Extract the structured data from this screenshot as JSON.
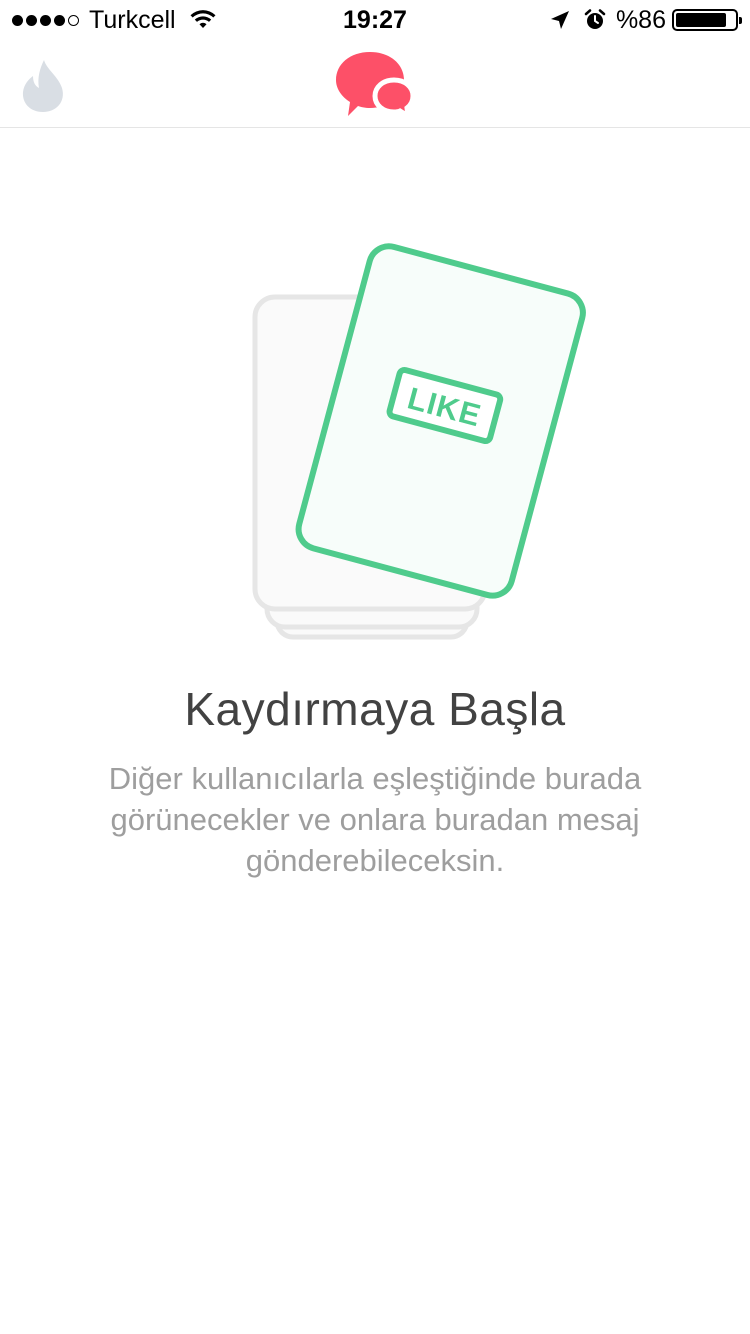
{
  "status_bar": {
    "signal_bars": 4,
    "signal_max": 5,
    "carrier": "Turkcell",
    "time": "19:27",
    "battery_text": "%86",
    "battery_level": 0.86
  },
  "nav": {
    "left_icon": "flame-icon",
    "center_icon": "chat-bubbles-icon"
  },
  "illustration": {
    "stamp_text": "LIKE"
  },
  "empty_state": {
    "title": "Kaydırmaya Başla",
    "description": "Diğer kullanıcılarla eşleştiğinde burada görünecekler ve onlara buradan mesaj gönderebileceksin."
  },
  "colors": {
    "brand": "#fd5068",
    "like_green": "#4fcb8c",
    "inactive_icon": "#d9dee4",
    "title_text": "#424242",
    "body_text": "#9e9e9e"
  }
}
